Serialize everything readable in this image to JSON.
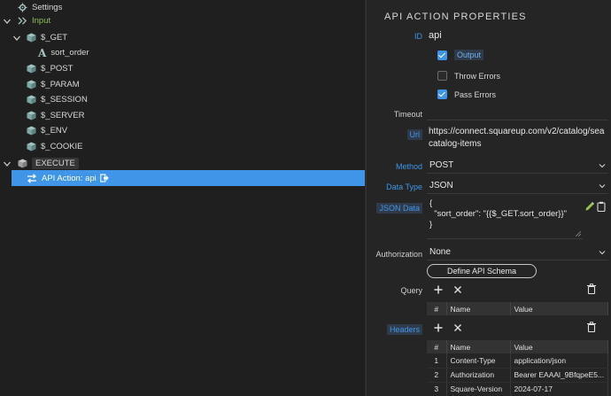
{
  "tree": {
    "settings_label": "Settings",
    "input_label": "Input",
    "get_label": "$_GET",
    "sort_order_label": "sort_order",
    "post_label": "$_POST",
    "param_label": "$_PARAM",
    "session_label": "$_SESSION",
    "server_label": "$_SERVER",
    "env_label": "$_ENV",
    "cookie_label": "$_COOKIE",
    "execute_label": "EXECUTE",
    "action_label": "API Action: api"
  },
  "props": {
    "title": "API ACTION PROPERTIES",
    "id_label": "ID",
    "id_value": "api",
    "output_label": "Output",
    "output_checked": true,
    "throw_errors_label": "Throw Errors",
    "throw_errors_checked": false,
    "pass_errors_label": "Pass Errors",
    "pass_errors_checked": true,
    "timeout_label": "Timeout",
    "timeout_value": "",
    "url_label": "Url",
    "url_line1": "https://connect.squareup.com/v2/catalog/sea",
    "url_line2": "catalog-items",
    "method_label": "Method",
    "method_value": "POST",
    "datatype_label": "Data Type",
    "datatype_value": "JSON",
    "jsondata_label": "JSON Data",
    "json_line1": "{",
    "json_line2": "  \"sort_order\": \"{{$_GET.sort_order}}\"",
    "json_line3": "}",
    "authorization_label": "Authorization",
    "authorization_value": "None",
    "define_schema_label": "Define API Schema",
    "query_label": "Query",
    "headers_label": "Headers",
    "col_num": "#",
    "col_name": "Name",
    "col_value": "Value",
    "headers": [
      {
        "num": "1",
        "name": "Content-Type",
        "value": "application/json"
      },
      {
        "num": "2",
        "name": "Authorization",
        "value": "Bearer EAAAl_9BfqpeE5..."
      },
      {
        "num": "3",
        "name": "Square-Version",
        "value": "2024-07-17"
      }
    ]
  },
  "colors": {
    "accent": "#3f96e8",
    "cube": "#7fa7a5",
    "input_green": "#8fbf5a"
  }
}
